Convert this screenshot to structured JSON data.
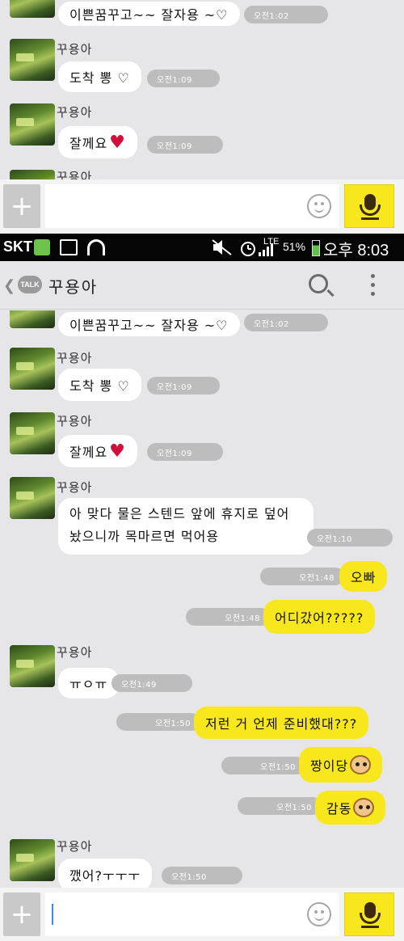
{
  "contact_name": "꾸용아",
  "status_bar": {
    "carrier": "SKT",
    "network": "LTE",
    "battery": "51%",
    "time": "오후 8:03"
  },
  "header": {
    "talk_badge": "TALK",
    "title": "꾸용아"
  },
  "top_screen": {
    "messages": [
      {
        "text": "이쁜꿈꾸고~~ 잘자용 ~♡",
        "time": "오전1:02"
      },
      {
        "sender": "꾸용아",
        "text": "도착 뽕 ♡",
        "time": "오전1:09"
      },
      {
        "sender": "꾸용아",
        "text": "잘께요",
        "time": "오전1:09"
      },
      {
        "sender": "꾸용아"
      }
    ]
  },
  "main_screen": {
    "messages": [
      {
        "text": "이쁜꿈꾸고~~ 잘자용 ~♡",
        "time": "오전1:02"
      },
      {
        "sender": "꾸용아",
        "text": "도착 뽕 ♡",
        "time": "오전1:09"
      },
      {
        "sender": "꾸용아",
        "text": "잘께요",
        "time": "오전1:09"
      },
      {
        "sender": "꾸용아",
        "text": "아 맞다 물은 스텐드 앞에 휴지로 덮어놨으니까 목마르면 먹어용",
        "time": "오전1:10"
      },
      {
        "text": "오빠",
        "time": "오전1:48"
      },
      {
        "text": "어디갔어?????",
        "time": "오전1:48"
      },
      {
        "sender": "꾸용아",
        "text": "ㅠㅇㅠ",
        "time": "오전1:49"
      },
      {
        "text": "저런 거 언제 준비했대???",
        "time": "오전1:50"
      },
      {
        "text": "짱이당",
        "time": "오전1:50"
      },
      {
        "text": "감동",
        "time": "오전1:50"
      },
      {
        "sender": "꾸용아",
        "text": "깼어?ㅜㅜㅜ",
        "time": "오전1:50"
      }
    ]
  },
  "input": {
    "plus_label": "+"
  }
}
